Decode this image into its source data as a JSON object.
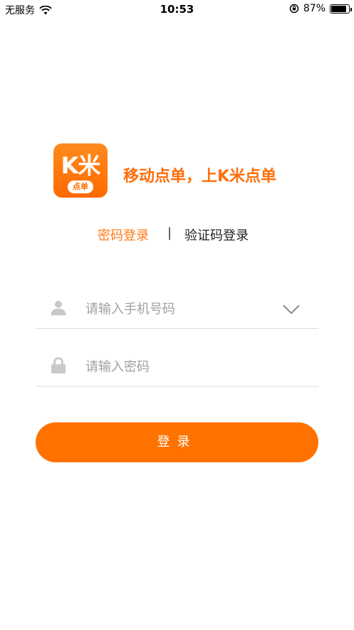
{
  "status_bar": {
    "carrier": "无服务",
    "time": "10:53",
    "battery_percent": "87%",
    "battery_level": 0.87,
    "icons": [
      "wifi-icon",
      "orientation-lock-icon",
      "battery-icon"
    ]
  },
  "brand": {
    "logo_text": "K米",
    "logo_sub": "点单",
    "slogan": "移动点单，上K米点单",
    "accent_color": "#ff7200"
  },
  "tabs": {
    "password_login": "密码登录",
    "divider": "|",
    "sms_login": "验证码登录",
    "active": "password_login"
  },
  "form": {
    "phone": {
      "placeholder": "请输入手机号码",
      "value": "",
      "icon": "user-icon",
      "trailing_icon": "chevron-down-icon"
    },
    "password": {
      "placeholder": "请输入密码",
      "value": "",
      "icon": "lock-icon"
    }
  },
  "login_button": {
    "label": "登录"
  }
}
